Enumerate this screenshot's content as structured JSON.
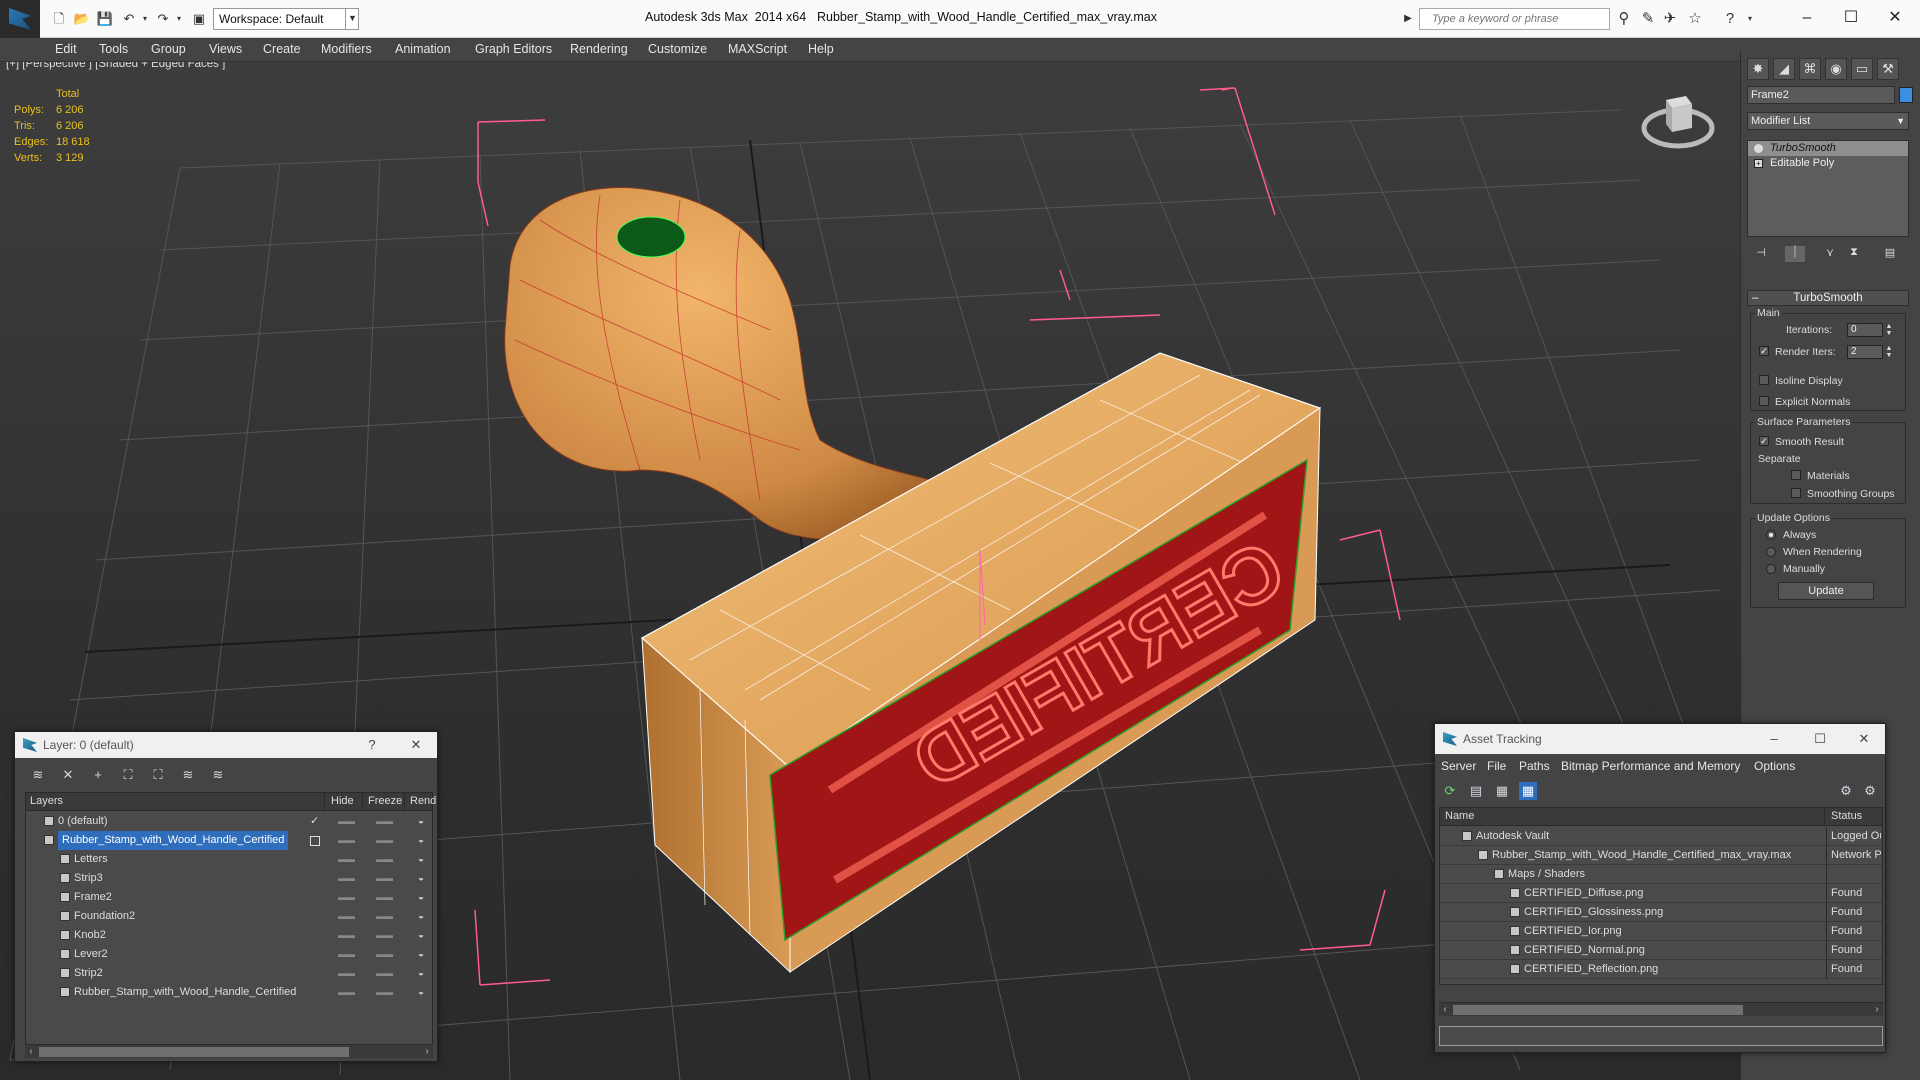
{
  "titlebar": {
    "workspace": "Workspace: Default",
    "app_title": "Autodesk 3ds Max  2014 x64",
    "file_title": "Rubber_Stamp_with_Wood_Handle_Certified_max_vray.max",
    "search_placeholder": "Type a keyword or phrase"
  },
  "menu": [
    "Edit",
    "Tools",
    "Group",
    "Views",
    "Create",
    "Modifiers",
    "Animation",
    "Graph Editors",
    "Rendering",
    "Customize",
    "MAXScript",
    "Help"
  ],
  "viewport": {
    "label": "[+] [Perspective ] [Shaded + Edged Faces ]",
    "stats": {
      "header": "Total",
      "rows": [
        {
          "k": "Polys:",
          "v": "6 206"
        },
        {
          "k": "Tris:",
          "v": "6 206"
        },
        {
          "k": "Edges:",
          "v": "18 618"
        },
        {
          "k": "Verts:",
          "v": "3 129"
        }
      ]
    }
  },
  "command_panel": {
    "object_name": "Frame2",
    "modifier_list": "Modifier List",
    "stack": [
      {
        "label": "TurboSmooth",
        "active": true
      },
      {
        "label": "Editable Poly",
        "active": false
      }
    ],
    "rollout_title": "TurboSmooth",
    "main_group": "Main",
    "iterations_label": "Iterations:",
    "iterations_value": "0",
    "render_iters_label": "Render Iters:",
    "render_iters_value": "2",
    "isoline_label": "Isoline Display",
    "explicit_normals_label": "Explicit Normals",
    "surface_group": "Surface Parameters",
    "smooth_result_label": "Smooth Result",
    "separate_label": "Separate",
    "materials_label": "Materials",
    "smoothing_groups_label": "Smoothing Groups",
    "update_group": "Update Options",
    "always_label": "Always",
    "when_rendering_label": "When Rendering",
    "manually_label": "Manually",
    "update_button": "Update"
  },
  "layer_dialog": {
    "title": "Layer: 0 (default)",
    "help": "?",
    "columns": [
      "Layers",
      "Hide",
      "Freeze",
      "Rend"
    ],
    "rows": [
      {
        "name": "0 (default)",
        "level": 0,
        "checked": true
      },
      {
        "name": "Rubber_Stamp_with_Wood_Handle_Certified",
        "level": 0,
        "selected": true
      },
      {
        "name": "Letters",
        "level": 1
      },
      {
        "name": "Strip3",
        "level": 1
      },
      {
        "name": "Frame2",
        "level": 1
      },
      {
        "name": "Foundation2",
        "level": 1
      },
      {
        "name": "Knob2",
        "level": 1
      },
      {
        "name": "Lever2",
        "level": 1
      },
      {
        "name": "Strip2",
        "level": 1
      },
      {
        "name": "Rubber_Stamp_with_Wood_Handle_Certified",
        "level": 1
      }
    ]
  },
  "asset_dialog": {
    "title": "Asset Tracking",
    "menu": [
      "Server",
      "File",
      "Paths",
      "Bitmap Performance and Memory",
      "Options"
    ],
    "columns": [
      "Name",
      "Status"
    ],
    "rows": [
      {
        "name": "Autodesk Vault",
        "status": "Logged Ou",
        "level": 0
      },
      {
        "name": "Rubber_Stamp_with_Wood_Handle_Certified_max_vray.max",
        "status": "Network P",
        "level": 1
      },
      {
        "name": "Maps / Shaders",
        "status": "",
        "level": 2
      },
      {
        "name": "CERTIFIED_Diffuse.png",
        "status": "Found",
        "level": 3
      },
      {
        "name": "CERTIFIED_Glossiness.png",
        "status": "Found",
        "level": 3
      },
      {
        "name": "CERTIFIED_Ior.png",
        "status": "Found",
        "level": 3
      },
      {
        "name": "CERTIFIED_Normal.png",
        "status": "Found",
        "level": 3
      },
      {
        "name": "CERTIFIED_Reflection.png",
        "status": "Found",
        "level": 3
      }
    ]
  },
  "icons": {
    "new": "new-file-icon",
    "open": "open-file-icon",
    "save": "save-icon",
    "undo": "undo-icon",
    "redo": "redo-icon",
    "binoculars": "binoculars-icon",
    "star": "star-icon",
    "help": "help-icon"
  },
  "colors": {
    "accent": "#2e6ebc",
    "stats": "#e8c020",
    "wire": "#e0304a",
    "wood": "#d99a52",
    "rubber": "#a01515"
  }
}
